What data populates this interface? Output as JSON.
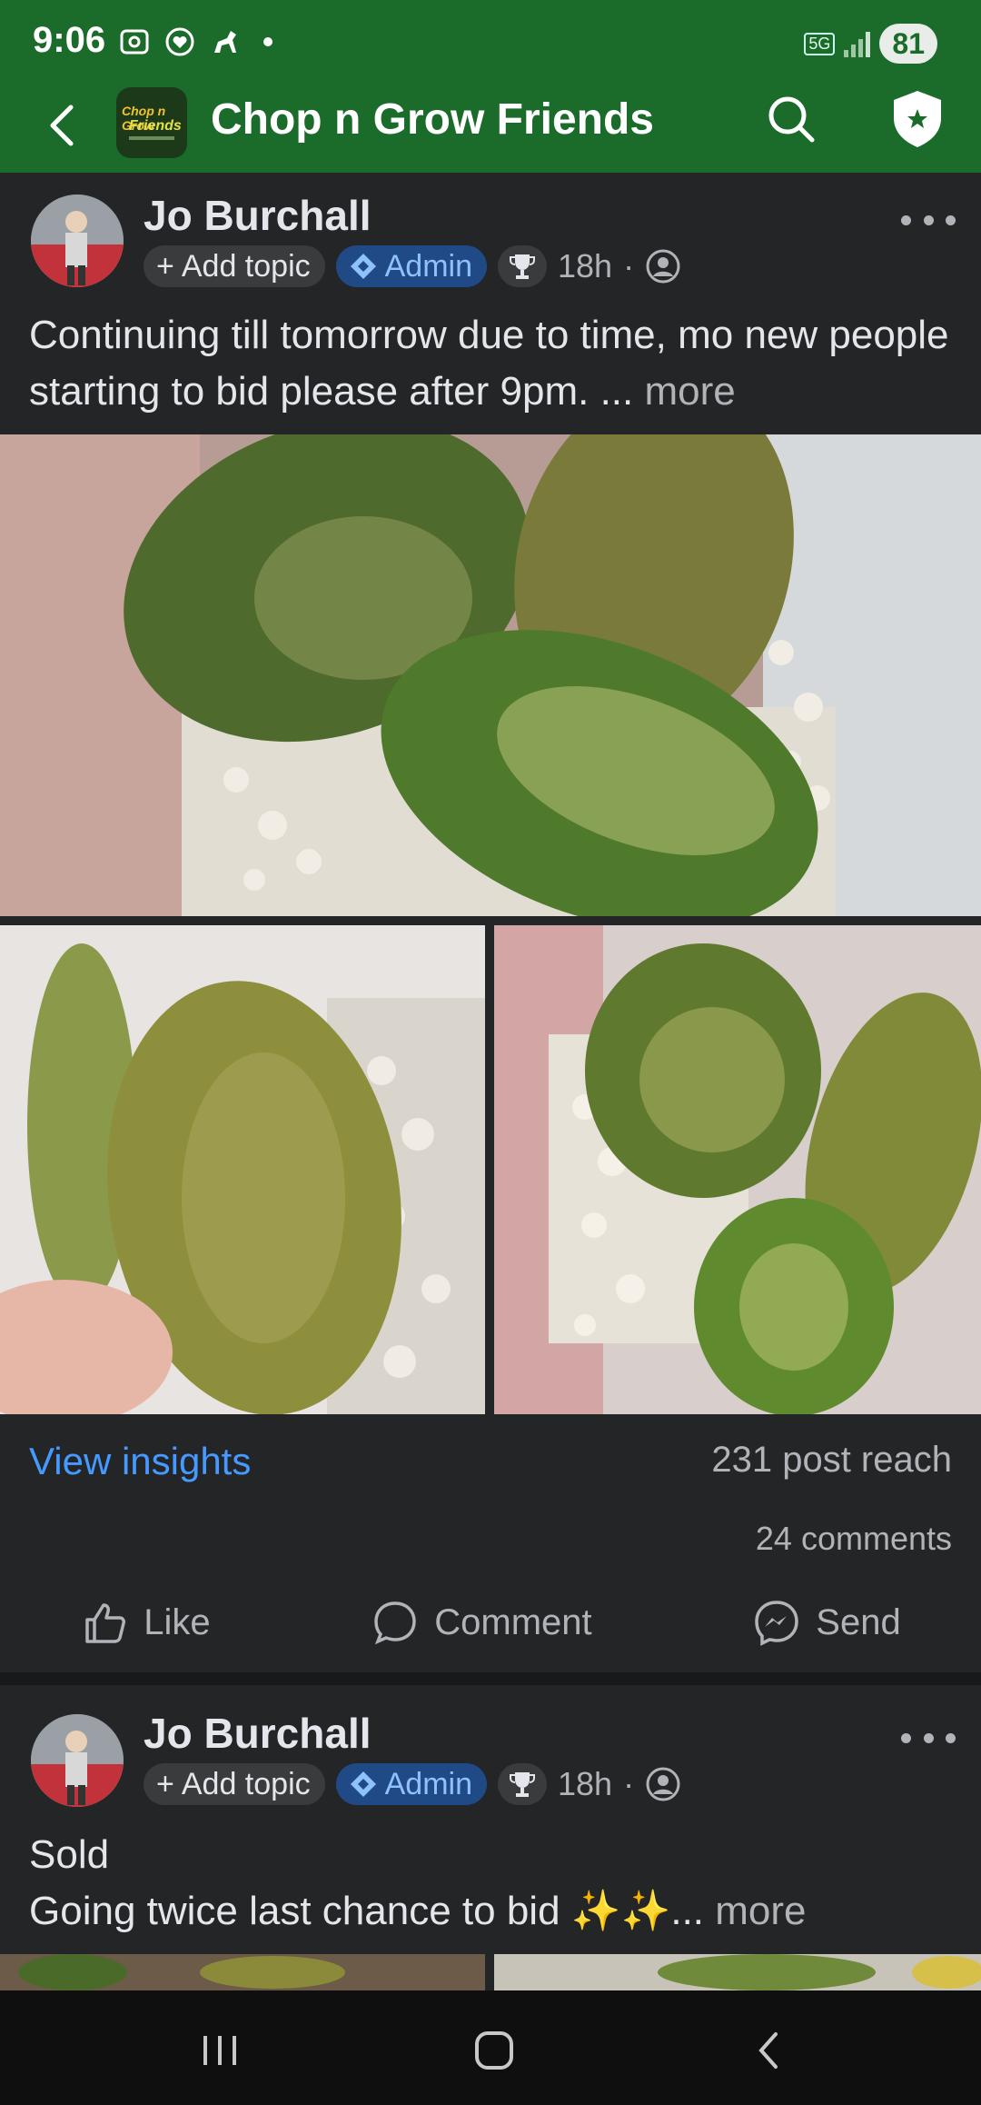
{
  "status": {
    "time": "9:06",
    "battery": "81",
    "network": "5G"
  },
  "appbar": {
    "title": "Chop n Grow Friends",
    "logo_line1": "Chop n Grow",
    "logo_line2": "Friends"
  },
  "posts": [
    {
      "author": "Jo Burchall",
      "topic_label": "Add topic",
      "badge": "Admin",
      "time": "18h",
      "text": "Continuing till tomorrow due to time,  mo new people starting to bid please after 9pm. ...",
      "more": "more",
      "insights": "View insights",
      "reach": "231 post reach",
      "comments": "24 comments"
    },
    {
      "author": "Jo Burchall",
      "topic_label": "Add topic",
      "badge": "Admin",
      "time": "18h",
      "text_line1": "Sold",
      "text_line2": "Going twice last chance to bid ✨✨...",
      "more": "more"
    }
  ],
  "actions": {
    "like": "Like",
    "comment": "Comment",
    "send": "Send"
  },
  "icons": {
    "back": "chevron-left-icon",
    "search": "search-icon",
    "shield": "shield-star-icon"
  },
  "colors": {
    "appbar": "#1b6b2a",
    "link": "#4599ff",
    "admin_bg": "#1f4a86"
  }
}
